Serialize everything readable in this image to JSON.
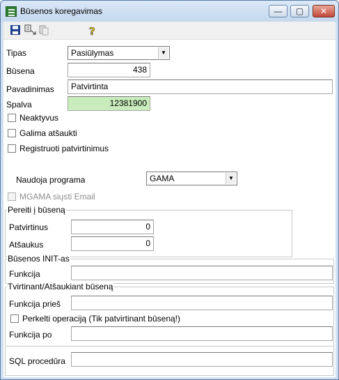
{
  "window": {
    "title": "Būsenos koregavimas",
    "buttons": {
      "minimize": "—",
      "maximize": "▢",
      "close": "✕"
    }
  },
  "toolbar": {
    "icons": [
      "save-icon",
      "copy-format-icon",
      "paste-icon",
      "help-icon"
    ]
  },
  "form": {
    "tipas": {
      "label": "Tipas",
      "value": "Pasiūlymas"
    },
    "busena": {
      "label": "Būsena",
      "value": "438"
    },
    "pavadinimas": {
      "label": "Pavadinimas",
      "value": "Patvirtinta"
    },
    "spalva": {
      "label": "Spalva",
      "value": "12381900",
      "color": "#c8ecbc"
    },
    "neaktyvus": {
      "label": "Neaktyvus",
      "checked": false
    },
    "galima_atsaukti": {
      "label": "Galima atšaukti",
      "checked": false
    },
    "registruoti": {
      "label": "Registruoti patvirtinimus",
      "checked": false
    },
    "naudoja_programa": {
      "label": "Naudoja programa",
      "value": "GAMA"
    },
    "mgama_email": {
      "label": "MGAMA siųsti Email",
      "checked": false,
      "disabled": true
    }
  },
  "pereiti": {
    "title": "Pereiti į būseną",
    "patvirtinus": {
      "label": "Patvirtinus",
      "value": "0"
    },
    "atsaukus": {
      "label": "Atšaukus",
      "value": "0"
    }
  },
  "init": {
    "title": "Būsenos INIT-as",
    "funkcija": {
      "label": "Funkcija",
      "value": ""
    }
  },
  "tvirtinant": {
    "title": "Tvirtinant/Atšaukiant būseną",
    "funkcija_pries": {
      "label": "Funkcija prieš",
      "value": ""
    },
    "perkelti": {
      "label": "Perkelti operaciją (Tik patvirtinant būseną!)",
      "checked": false
    },
    "funkcija_po": {
      "label": "Funkcija po",
      "value": ""
    },
    "sql": {
      "label": "SQL procedūra",
      "value": ""
    }
  }
}
